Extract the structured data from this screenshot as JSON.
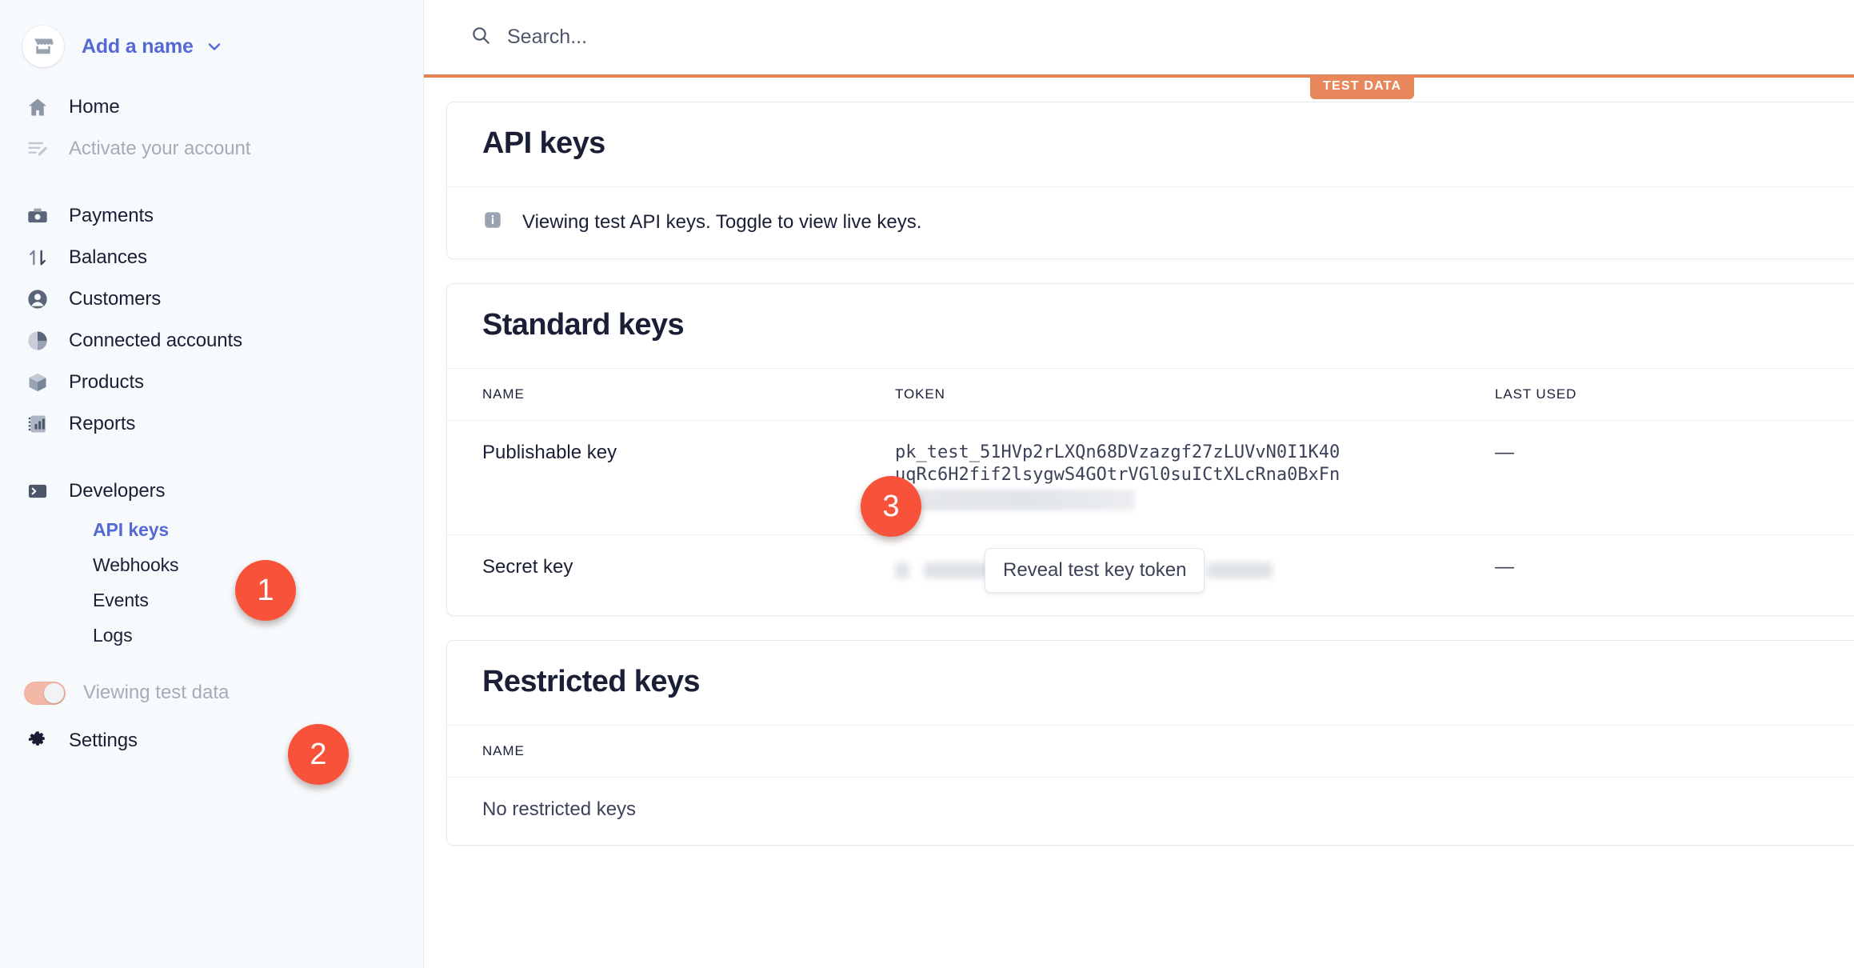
{
  "sidebar": {
    "brand": {
      "name": "Add a name",
      "avatar_icon": "storefront-icon",
      "caret_icon": "chevron-down-icon"
    },
    "primary_items": [
      {
        "label": "Home",
        "icon": "home-icon",
        "state": "default"
      },
      {
        "label": "Activate your account",
        "icon": "activate-account-icon",
        "state": "muted"
      }
    ],
    "nav_items": [
      {
        "label": "Payments",
        "icon": "payments-icon"
      },
      {
        "label": "Balances",
        "icon": "balances-icon"
      },
      {
        "label": "Customers",
        "icon": "customers-icon"
      },
      {
        "label": "Connected accounts",
        "icon": "connected-accounts-icon"
      },
      {
        "label": "Products",
        "icon": "products-icon"
      },
      {
        "label": "Reports",
        "icon": "reports-icon"
      }
    ],
    "developers": {
      "label": "Developers",
      "icon": "terminal-icon"
    },
    "developers_subitems": [
      {
        "label": "API keys",
        "state": "active"
      },
      {
        "label": "Webhooks",
        "state": "default"
      },
      {
        "label": "Events",
        "state": "default"
      },
      {
        "label": "Logs",
        "state": "default"
      }
    ],
    "test_toggle": {
      "label": "Viewing test data",
      "state": "on"
    },
    "settings": {
      "label": "Settings",
      "icon": "gear-icon"
    }
  },
  "topbar": {
    "search_placeholder": "Search...",
    "search_icon": "search-icon"
  },
  "test_banner": {
    "label": "TEST DATA",
    "color": "#e8875b"
  },
  "page": {
    "title": "API keys",
    "notice": {
      "icon": "info-icon",
      "text": "Viewing test API keys. Toggle to view live keys."
    }
  },
  "standard_keys": {
    "title": "Standard keys",
    "columns": [
      "NAME",
      "TOKEN",
      "LAST USED"
    ],
    "rows": [
      {
        "name": "Publishable key",
        "token_line1": "pk_test_51HVp2rLXQn68DVzazgf27zLUVvN0I1K40",
        "token_line2": "uqRc6H2fif2lsygwS4GOtrVGl0suICtXLcRna0BxFn",
        "token_line3_redacted": true,
        "last_used": "—"
      },
      {
        "name": "Secret key",
        "token_redacted": true,
        "reveal_button": "Reveal test key token",
        "last_used": "—"
      }
    ]
  },
  "restricted_keys": {
    "title": "Restricted keys",
    "columns": [
      "NAME"
    ],
    "empty_text": "No restricted keys"
  },
  "annotations": [
    {
      "number": "1"
    },
    {
      "number": "2"
    },
    {
      "number": "3"
    }
  ],
  "colors": {
    "accent_blue": "#5469d4",
    "test_orange": "#e8875b",
    "badge_red": "#f9523a",
    "text_dark": "#1a1f36",
    "text_muted": "#a3acb9"
  }
}
